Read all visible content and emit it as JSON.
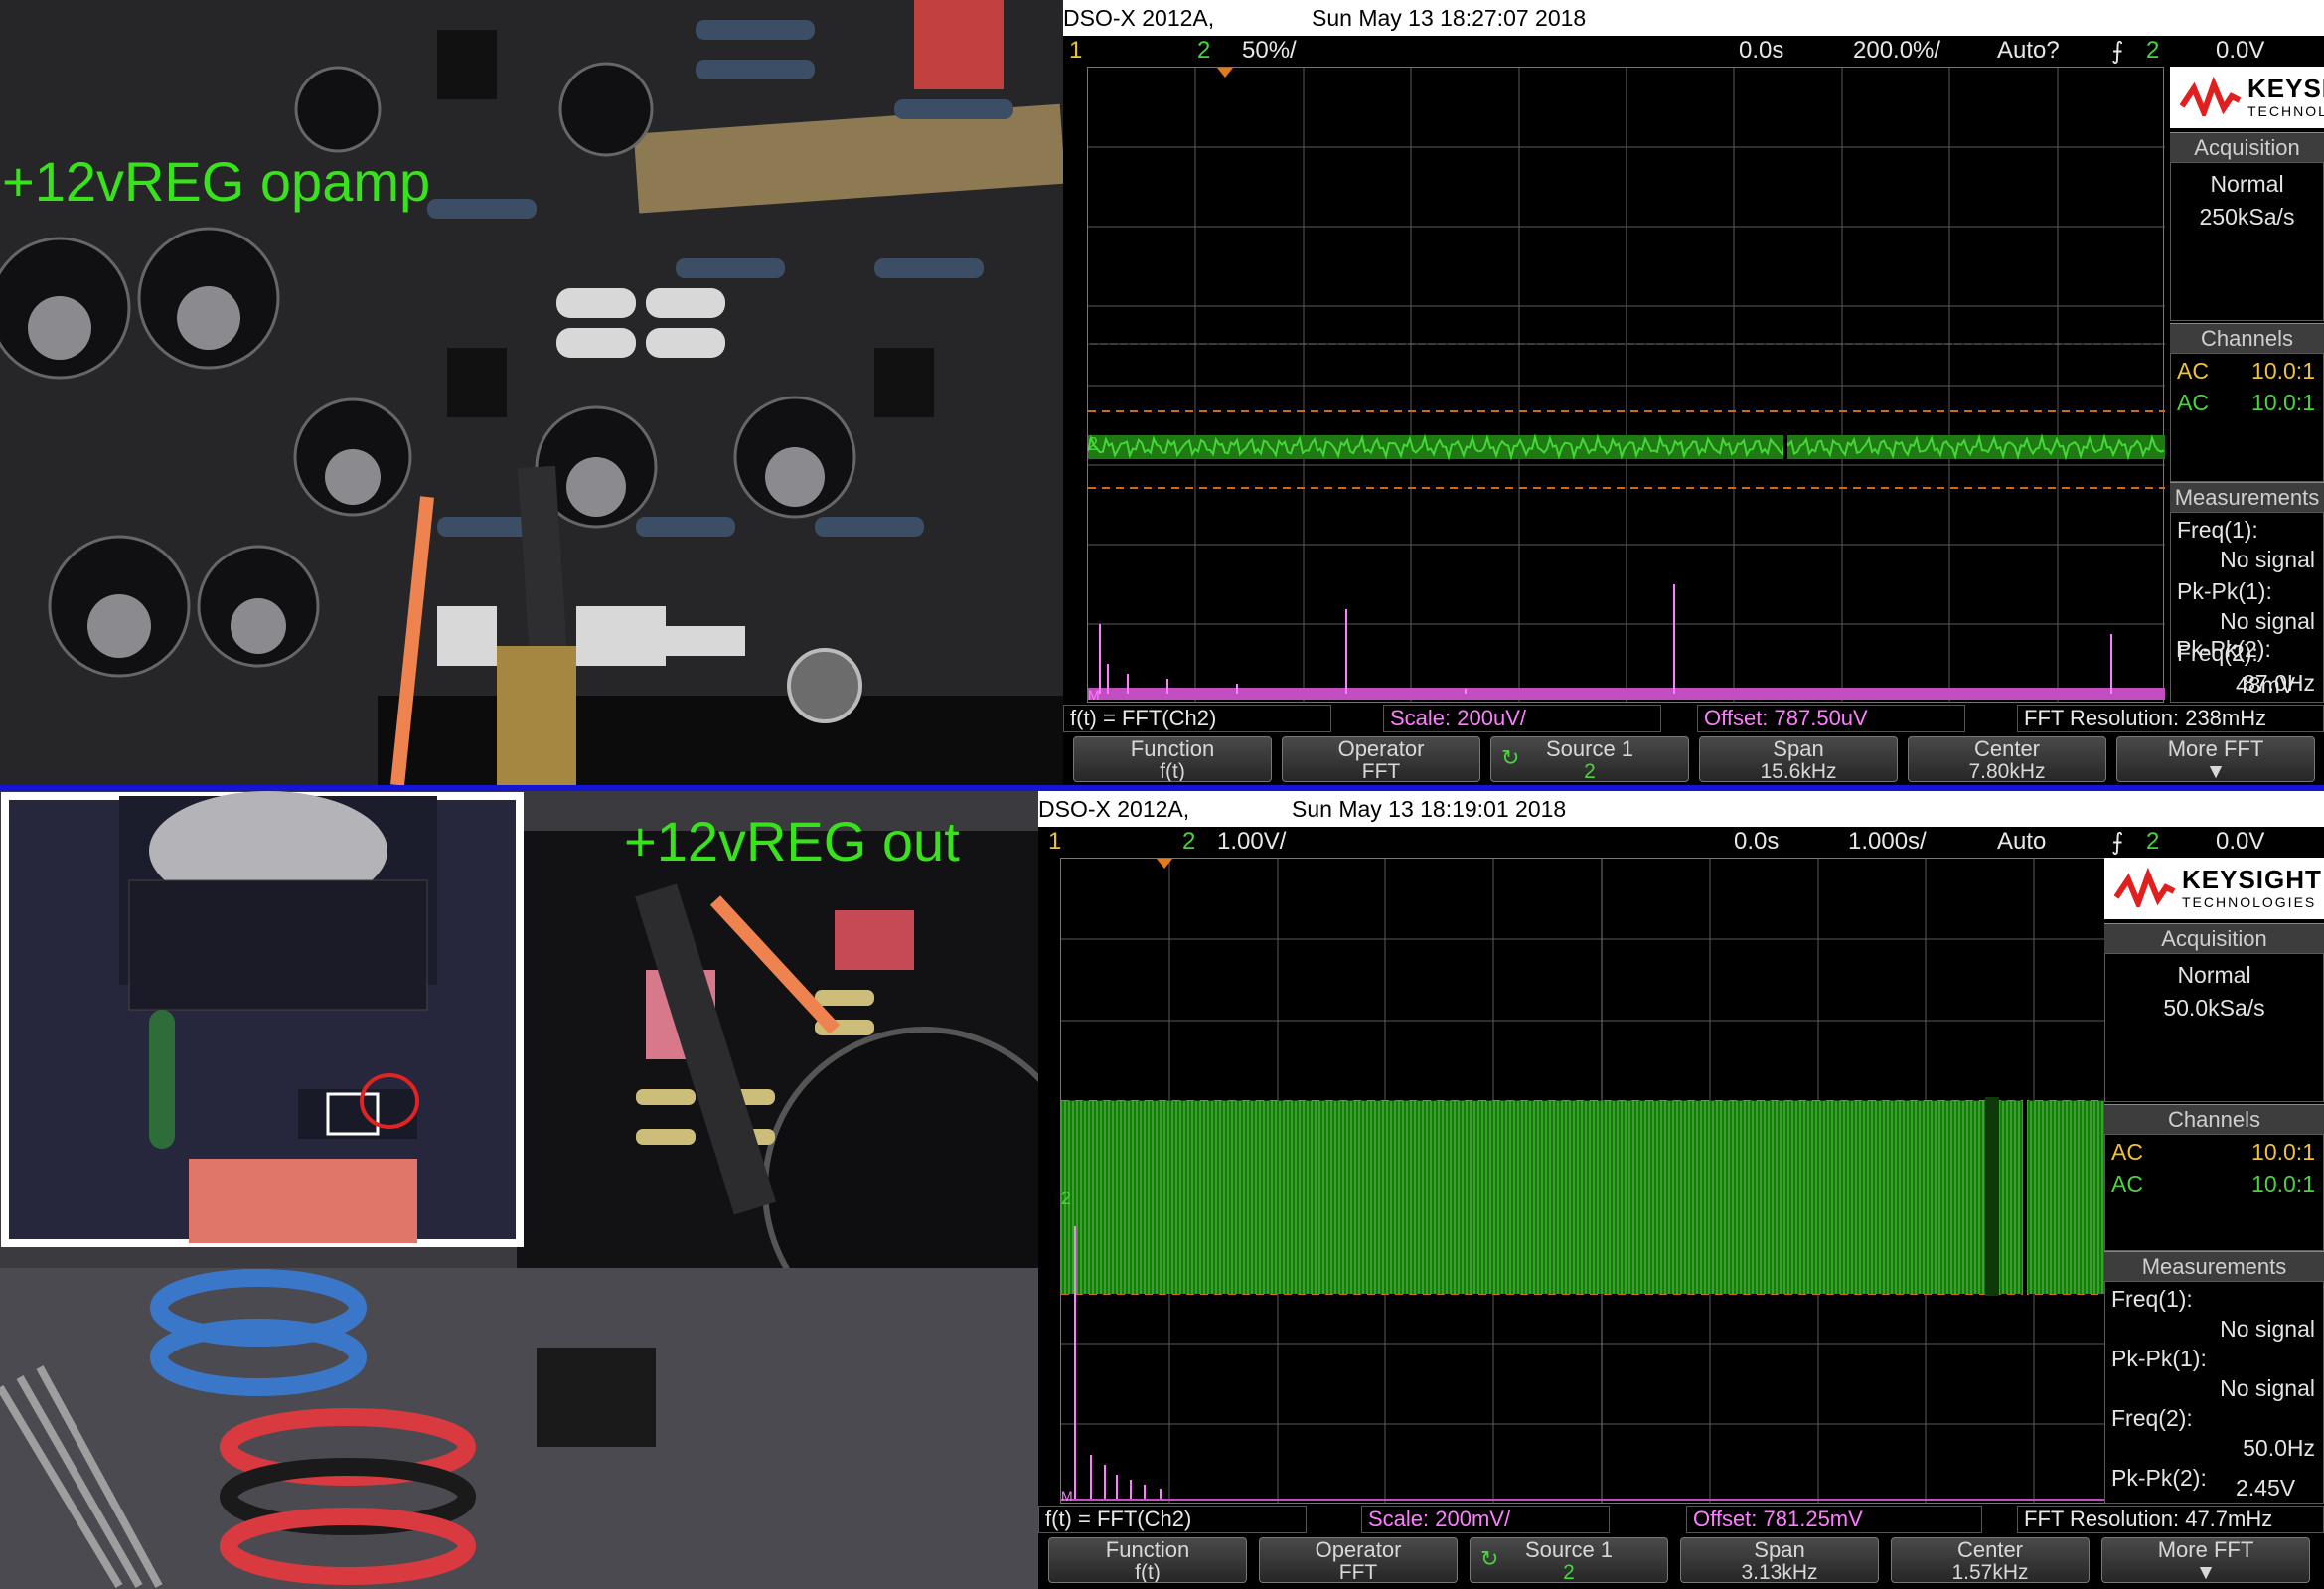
{
  "photo_top": {
    "label": "+12vREG opamp"
  },
  "photo_bottom": {
    "label": "+12vREG out"
  },
  "scopes": [
    {
      "model": "DSO-X 2012A,",
      "datetime": "Sun May 13 18:27:07 2018",
      "ch1": "1",
      "ch2": "2",
      "ch2_scale": "50%/",
      "time_pos": "0.0s",
      "timebase": "200.0%/",
      "trigger_mode": "Auto?",
      "trig_icon": "trigger-edge-icon",
      "trig_ch": "2",
      "trig_level": "0.0V",
      "brand": "KEYSIGHT",
      "brand_sub": "TECHNOLOGIES",
      "acquisition_title": "Acquisition",
      "acq_mode": "Normal",
      "acq_rate": "250kSa/s",
      "channels_title": "Channels",
      "channels": [
        {
          "coupling": "AC",
          "probe": "10.0:1"
        },
        {
          "coupling": "AC",
          "probe": "10.0:1"
        }
      ],
      "measurements_title": "Measurements",
      "measurements": [
        {
          "label": "Freq(1):",
          "value": "No signal"
        },
        {
          "label": "Pk-Pk(1):",
          "value": "No signal"
        },
        {
          "label": "Freq(2):",
          "value": "87.0Hz"
        },
        {
          "label": "Pk-Pk(2):",
          "value": "48mV"
        }
      ],
      "fft": {
        "fn": "f(t) = FFT(Ch2)",
        "scale": "Scale: 200uV/",
        "offset": "Offset: 787.50uV",
        "resolution": "FFT Resolution: 238mHz"
      },
      "softkeys": [
        {
          "l1": "Function",
          "l2": "f(t)"
        },
        {
          "l1": "Operator",
          "l2": "FFT"
        },
        {
          "l1": "Source 1",
          "l2": "2"
        },
        {
          "l1": "Span",
          "l2": "15.6kHz"
        },
        {
          "l1": "Center",
          "l2": "7.80kHz"
        },
        {
          "l1": "More FFT",
          "l2": ""
        }
      ],
      "colors": {
        "ch1": "#f1c232",
        "ch2": "#47d63a",
        "math": "#ff7dff"
      }
    },
    {
      "model": "DSO-X 2012A,",
      "datetime": "Sun May 13 18:19:01 2018",
      "ch1": "1",
      "ch2": "2",
      "ch2_scale": "1.00V/",
      "time_pos": "0.0s",
      "timebase": "1.000s/",
      "trigger_mode": "Auto",
      "trig_icon": "trigger-edge-icon",
      "trig_ch": "2",
      "trig_level": "0.0V",
      "brand": "KEYSIGHT",
      "brand_sub": "TECHNOLOGIES",
      "acquisition_title": "Acquisition",
      "acq_mode": "Normal",
      "acq_rate": "50.0kSa/s",
      "channels_title": "Channels",
      "channels": [
        {
          "coupling": "AC",
          "probe": "10.0:1"
        },
        {
          "coupling": "AC",
          "probe": "10.0:1"
        }
      ],
      "measurements_title": "Measurements",
      "measurements": [
        {
          "label": "Freq(1):",
          "value": "No signal"
        },
        {
          "label": "Pk-Pk(1):",
          "value": "No signal"
        },
        {
          "label": "Freq(2):",
          "value": "50.0Hz"
        },
        {
          "label": "Pk-Pk(2):",
          "value": "2.45V"
        }
      ],
      "fft": {
        "fn": "f(t) = FFT(Ch2)",
        "scale": "Scale: 200mV/",
        "offset": "Offset: 781.25mV",
        "resolution": "FFT Resolution: 47.7mHz"
      },
      "softkeys": [
        {
          "l1": "Function",
          "l2": "f(t)"
        },
        {
          "l1": "Operator",
          "l2": "FFT"
        },
        {
          "l1": "Source 1",
          "l2": "2"
        },
        {
          "l1": "Span",
          "l2": "3.13kHz"
        },
        {
          "l1": "Center",
          "l2": "1.57kHz"
        },
        {
          "l1": "More FFT",
          "l2": ""
        }
      ],
      "colors": {
        "ch1": "#f1c232",
        "ch2": "#47d63a",
        "math": "#ff7dff"
      }
    }
  ]
}
